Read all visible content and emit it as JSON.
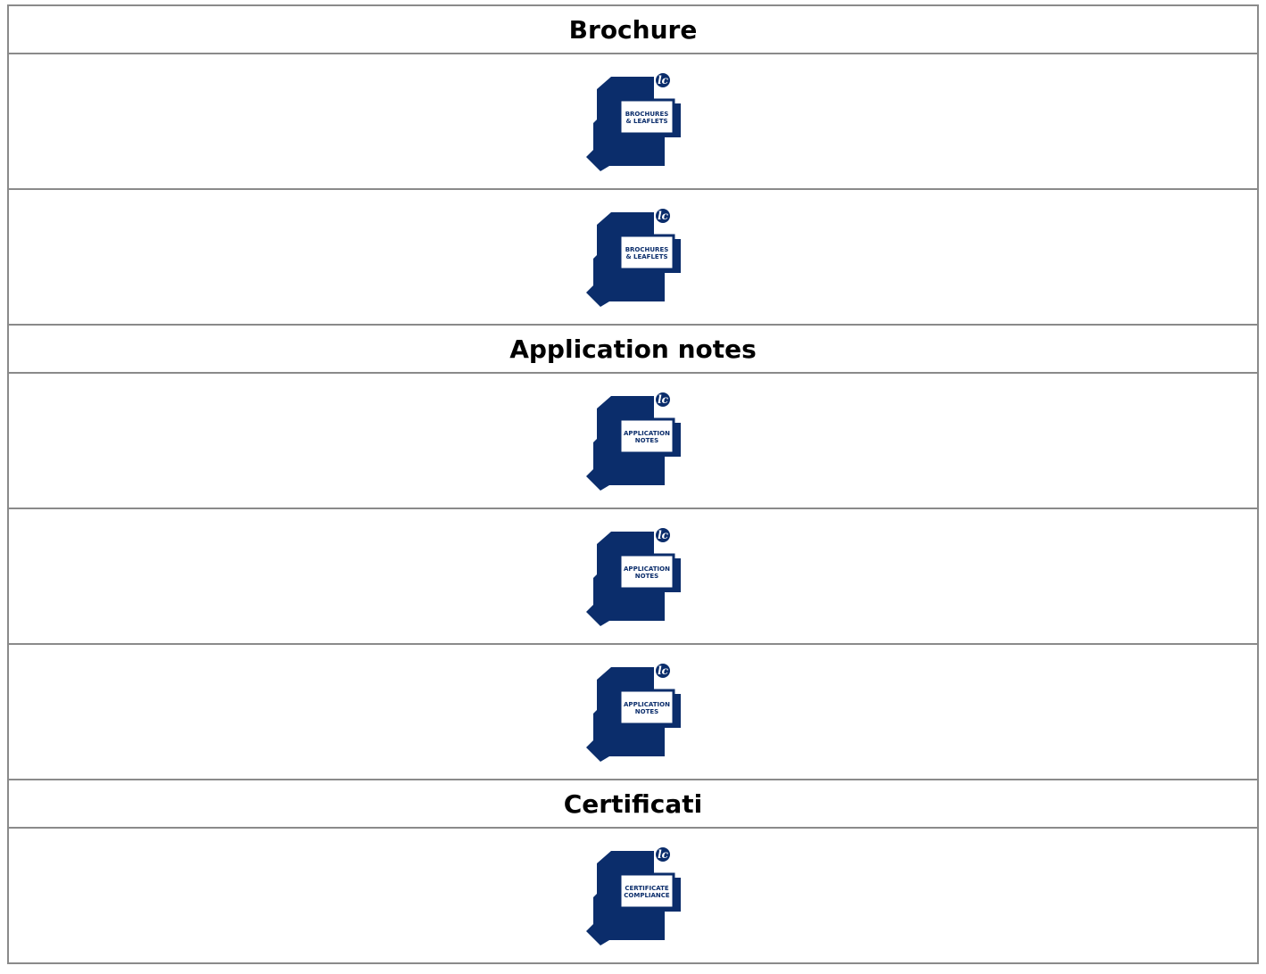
{
  "colors": {
    "icon_navy": "#0b2d6b",
    "border": "#8a8a8a"
  },
  "sections": [
    {
      "title": "Brochure",
      "documents": [
        {
          "icon": "brochures-leaflets-icon",
          "badge": "lc",
          "line1": "BROCHURES",
          "line2": "& LEAFLETS"
        },
        {
          "icon": "brochures-leaflets-icon",
          "badge": "lc",
          "line1": "BROCHURES",
          "line2": "& LEAFLETS"
        }
      ]
    },
    {
      "title": "Application notes",
      "documents": [
        {
          "icon": "application-notes-icon",
          "badge": "lc",
          "line1": "APPLICATION",
          "line2": "NOTES"
        },
        {
          "icon": "application-notes-icon",
          "badge": "lc",
          "line1": "APPLICATION",
          "line2": "NOTES"
        },
        {
          "icon": "application-notes-icon",
          "badge": "lc",
          "line1": "APPLICATION",
          "line2": "NOTES"
        }
      ]
    },
    {
      "title": "Certificati",
      "documents": [
        {
          "icon": "certificate-compliance-icon",
          "badge": "lc",
          "line1": "CERTIFICATE",
          "line2": "COMPLIANCE"
        }
      ]
    }
  ]
}
